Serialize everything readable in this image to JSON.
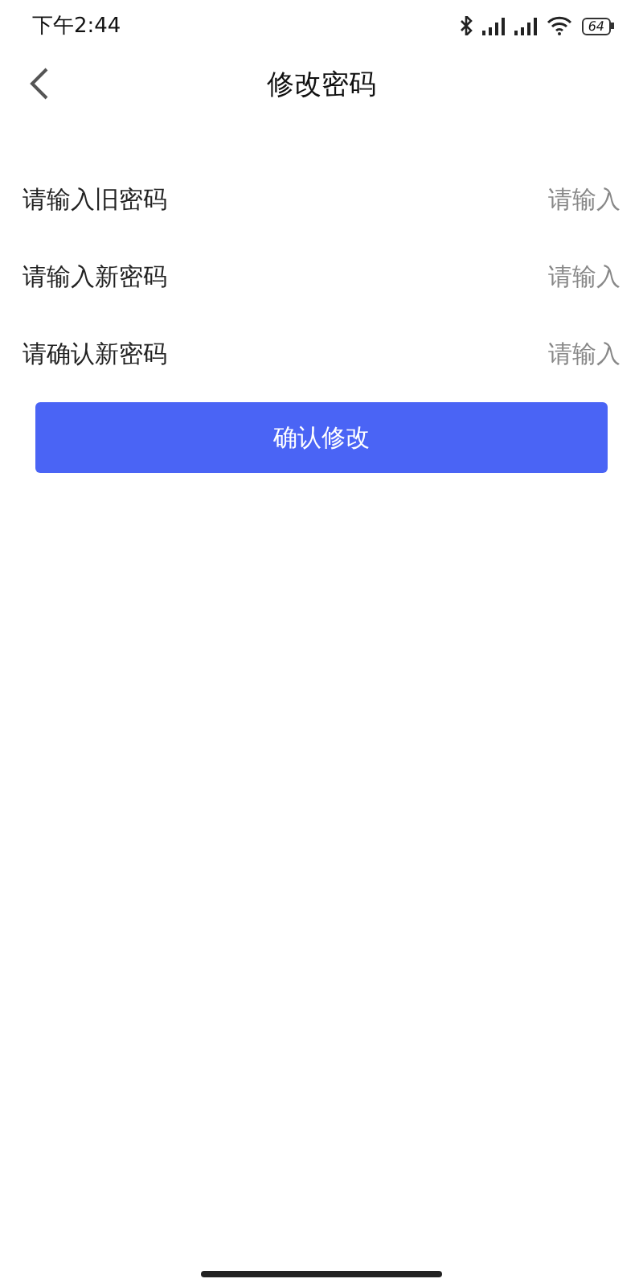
{
  "status_bar": {
    "time": "下午2:44",
    "battery": "64"
  },
  "nav": {
    "title": "修改密码"
  },
  "fields": [
    {
      "label": "请输入旧密码",
      "placeholder": "请输入"
    },
    {
      "label": "请输入新密码",
      "placeholder": "请输入"
    },
    {
      "label": "请确认新密码",
      "placeholder": "请输入"
    }
  ],
  "submit_button": "确认修改"
}
